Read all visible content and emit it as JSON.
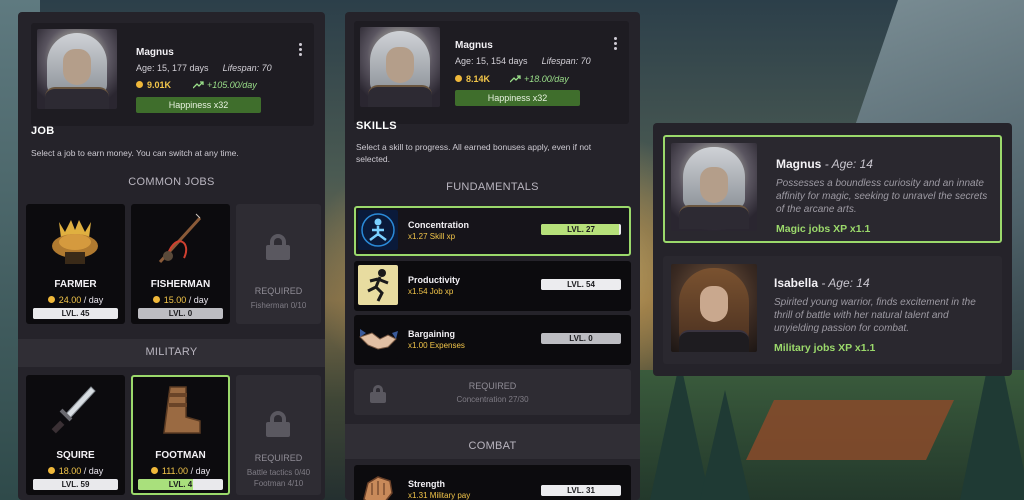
{
  "character": {
    "name": "Magnus",
    "age_job": "Age: 15, 177 days",
    "age_skills": "Age: 15, 154 days",
    "lifespan": "Lifespan: 70",
    "money_job": "9.01K",
    "money_skills": "8.14K",
    "rate_job": "+105.00/day",
    "rate_skills": "+18.00/day",
    "happiness": "Happiness x32"
  },
  "job_panel": {
    "title": "JOB",
    "description": "Select a job to earn money. You can switch at any time.",
    "categories": [
      {
        "name": "COMMON JOBS",
        "jobs": [
          {
            "name": "FARMER",
            "pay": "24.00",
            "per": "/ day",
            "level": "LVL. 45",
            "progress": 0.92,
            "icon": "farmer-hat-icon"
          },
          {
            "name": "FISHERMAN",
            "pay": "15.00",
            "per": "/ day",
            "level": "LVL. 0",
            "progress": 0,
            "icon": "fishing-rod-icon"
          },
          {
            "locked": true,
            "required": "REQUIRED",
            "requirement": "Fisherman 0/10"
          }
        ]
      },
      {
        "name": "MILITARY",
        "jobs": [
          {
            "name": "SQUIRE",
            "pay": "18.00",
            "per": "/ day",
            "level": "LVL. 59",
            "progress": 0.82,
            "icon": "dagger-icon"
          },
          {
            "name": "FOOTMAN",
            "pay": "111.00",
            "per": "/ day",
            "level": "LVL. 4",
            "progress": 0.65,
            "icon": "boot-icon",
            "selected": true
          },
          {
            "locked": true,
            "required": "REQUIRED",
            "requirement": "Battle tactics 0/40",
            "requirement2": "Footman 4/10"
          }
        ]
      }
    ]
  },
  "skills_panel": {
    "title": "SKILLS",
    "description": "Select a skill to progress. All earned bonuses apply, even if not selected.",
    "categories": [
      {
        "name": "FUNDAMENTALS",
        "skills": [
          {
            "name": "Concentration",
            "bonus": "x1.27 Skill xp",
            "level": "LVL. 27",
            "progress": 0.98,
            "icon": "meditation-icon",
            "selected": true
          },
          {
            "name": "Productivity",
            "bonus": "x1.54 Job xp",
            "level": "LVL. 54",
            "progress": 0.96,
            "icon": "running-man-icon"
          },
          {
            "name": "Bargaining",
            "bonus": "x1.00 Expenses",
            "level": "LVL. 0",
            "progress": 0,
            "icon": "handshake-icon"
          },
          {
            "locked": true,
            "required": "REQUIRED",
            "requirement": "Concentration 27/30"
          }
        ]
      },
      {
        "name": "COMBAT",
        "skills": [
          {
            "name": "Strength",
            "bonus": "x1.31 Military pay",
            "level": "LVL. 31",
            "progress": 0.95,
            "icon": "fist-icon"
          }
        ]
      }
    ]
  },
  "characters_panel": {
    "heroes": [
      {
        "name": "Magnus",
        "age": "- Age: 14",
        "description": "Possesses a boundless curiosity and an innate affinity for magic, seeking to unravel the secrets of the arcane arts.",
        "bonus": "Magic jobs XP x1.1",
        "selected": true
      },
      {
        "name": "Isabella",
        "age": "- Age: 14",
        "description": "Spirited young warrior, finds excitement in the thrill of battle with her natural talent and unyielding passion for combat.",
        "bonus": "Military jobs XP x1.1"
      }
    ]
  },
  "colors": {
    "accent_green": "#9bd96b",
    "gold": "#f3c64a",
    "panel_bg": "#25232a"
  }
}
